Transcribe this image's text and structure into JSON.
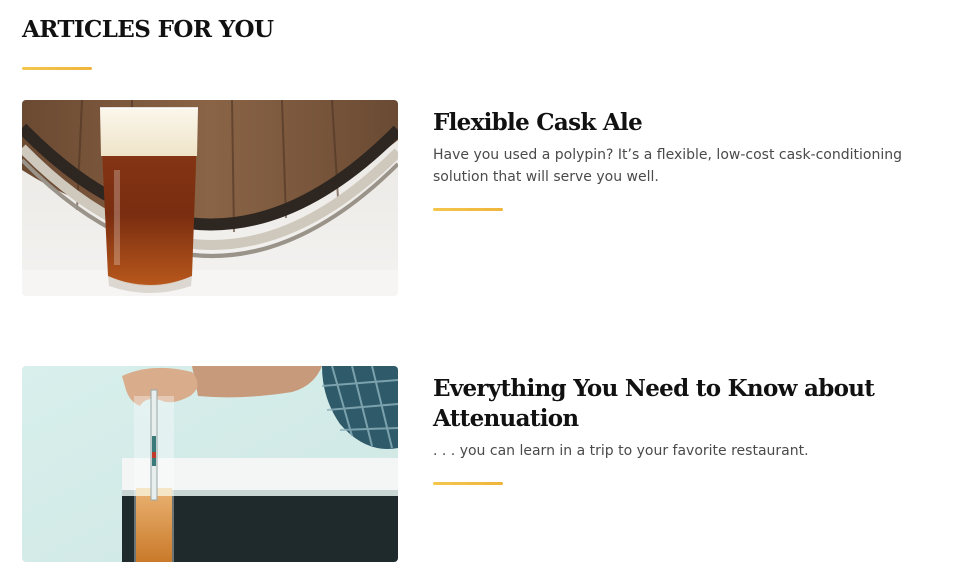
{
  "section": {
    "title": "ARTICLES FOR YOU"
  },
  "articles": [
    {
      "title": "Flexible Cask Ale",
      "description": "Have you used a polypin? It’s a flexible, low-cost cask-conditioning solution that will serve you well.",
      "image_alt": "Pint of amber ale in front of a wooden barrel"
    },
    {
      "title": "Everything You Need to Know about Attenuation",
      "description": ". . . you can learn in a trip to your favorite restaurant.",
      "image_alt": "Hydrometer being placed into a test jar of beer"
    }
  ],
  "colors": {
    "accent": "#f0b43c",
    "heading": "#111111",
    "body_text": "#4a4a4a"
  }
}
